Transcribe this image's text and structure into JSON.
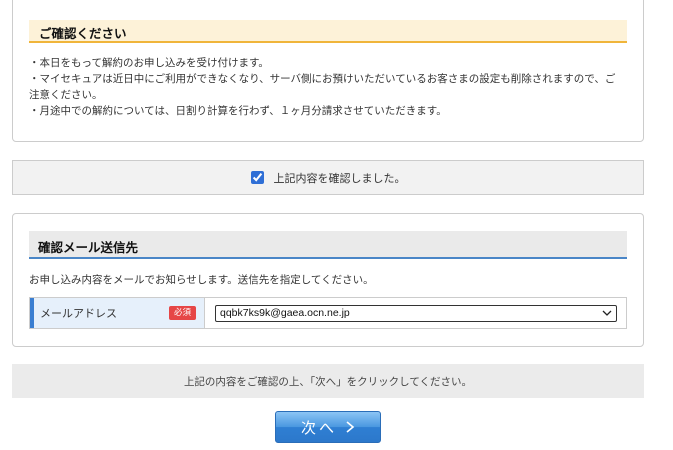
{
  "notice": {
    "title": "ご確認ください",
    "lines": [
      "・本日をもって解約のお申し込みを受け付けます。",
      "・マイセキュアは近日中にご利用ができなくなり、サーバ側にお預けいただいているお客さまの設定も削除されますので、ご",
      "注意ください。",
      "・月途中での解約については、日割り計算を行わず、１ヶ月分請求させていただきます。"
    ]
  },
  "confirm": {
    "label": "上記内容を確認しました。",
    "checked": true
  },
  "email_section": {
    "title": "確認メール送信先",
    "description": "お申し込み内容をメールでお知らせします。送信先を指定してください。",
    "field_label": "メールアドレス",
    "required_badge": "必須",
    "selected_email": "qqbk7ks9k@gaea.ocn.ne.jp"
  },
  "footer": {
    "instruction": "上記の内容をご確認の上、「次へ」をクリックしてください。",
    "next_label": "次へ"
  },
  "colors": {
    "accent_blue": "#3a7ed1",
    "notice_border": "#f0b53a",
    "required_red": "#e64646"
  },
  "icons": {
    "dropdown": "chevron-down-icon",
    "next": "chevron-right-icon"
  }
}
